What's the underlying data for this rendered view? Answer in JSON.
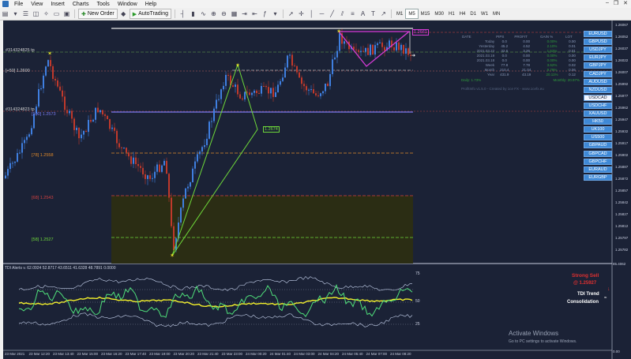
{
  "menu": {
    "items": [
      "File",
      "View",
      "Insert",
      "Charts",
      "Tools",
      "Window",
      "Help"
    ],
    "window_controls": [
      "–",
      "❐",
      "✕"
    ]
  },
  "toolbar": {
    "new_order": "New Order",
    "autotrading": "AutoTrading",
    "timeframes": [
      "M1",
      "M5",
      "M15",
      "M30",
      "H1",
      "H4",
      "D1",
      "W1",
      "MN"
    ],
    "active_timeframe": "M5"
  },
  "chart": {
    "order_labels": {
      "order1": "#314324825 tp",
      "order1_level": "[+50] 1.2600",
      "order2": "#314324823 tp"
    },
    "fib_labels": [
      "[100] 1.2573",
      "[78] 1.2558",
      "[68] 1.2543",
      "[58] 1.2527"
    ],
    "zigzag_price": "1.2674",
    "cursor_price": "1.2661",
    "current_price": "1.26074",
    "price_axis": [
      "1.26067",
      "1.26052",
      "1.26037",
      "1.26022",
      "1.26007",
      "1.25992",
      "1.25977",
      "1.25962",
      "1.25947",
      "1.25932",
      "1.25917",
      "1.25902",
      "1.25887",
      "1.25872",
      "1.25857",
      "1.25842",
      "1.25827",
      "1.25812",
      "1.25797",
      "1.25782"
    ],
    "time_axis": [
      "23 Mar 2021",
      "23 Mar 12:20",
      "23 Mar 13:40",
      "23 Mar 15:00",
      "23 Mar 16:20",
      "23 Mar 17:40",
      "23 Mar 19:00",
      "23 Mar 20:20",
      "23 Mar 21:40",
      "23 Mar 23:00",
      "24 Mar 00:20",
      "24 Mar 01:40",
      "24 Mar 03:00",
      "24 Mar 04:20",
      "24 Mar 05:40",
      "24 Mar 07:00",
      "24 Mar 08:20"
    ]
  },
  "stats": {
    "headers": [
      "DATE",
      "PIPS",
      "PROFIT",
      "GAIN %",
      "LOT"
    ],
    "rows": [
      [
        "Today",
        "0.0",
        "0.00",
        "0.00%",
        "0.00"
      ],
      [
        "Yesterday",
        "45.2",
        "4.52",
        "2.10%",
        "0.01"
      ],
      [
        "2021.03.22",
        "32.6",
        "3.26",
        "1.52%",
        "0.01"
      ],
      [
        "2021.03.19",
        "0.0",
        "0.00",
        "0.00%",
        "0.00"
      ],
      [
        "2021.03.18",
        "0.0",
        "0.00",
        "0.00%",
        "0.00"
      ],
      [
        "Week",
        "77.8",
        "7.78",
        "3.62%",
        "0.02"
      ],
      [
        "Month",
        "210.4",
        "21.04",
        "9.79%",
        "0.06"
      ],
      [
        "Year",
        "431.9",
        "43.19",
        "20.11%",
        "0.12"
      ]
    ],
    "daily": "Daily: 1.73%",
    "monthly": "Monthly: 20.97%",
    "footer": "ProfitInfo v1.5.0 - Created by 1ce FX - www.1cefx.eu"
  },
  "symbols": [
    "EURUSD",
    "GBPUSD",
    "USDJPY",
    "EURJPY",
    "GBPJPY",
    "CADJPY",
    "AUDUSD",
    "NZDUSD",
    "USDCAD",
    "USDCHF",
    "XAUUSD",
    "HK50",
    "UK100",
    "US500",
    "GBPAUD",
    "GBPCAD",
    "GBPCHF",
    "EURAUD",
    "EURGBP"
  ],
  "selected_symbol": "USDCAD",
  "tdi": {
    "header": "TDI Alerts v. 62.0924 52.8717 43.6511 41.6328 48.7891 0.0000",
    "levels": [
      "75",
      "50",
      "25"
    ],
    "signal": "Strong Sell",
    "signal_price": "@ 1.25927",
    "trend": "TDI Trend",
    "consolidation": "Consolidation",
    "max": "85.4062",
    "min": "0.00"
  },
  "watermark": {
    "title": "Activate Windows",
    "subtitle": "Go to PC settings to activate Windows."
  },
  "colors": {
    "bg": "#1b2236",
    "bull": "#3f7fe0",
    "bear": "#c0392b",
    "zigzag": "#6ed83a",
    "pattern": "#d63ad6",
    "tdi_yellow": "#f4f12a",
    "tdi_green": "#4fe07a",
    "band": "#c7d3ee"
  }
}
